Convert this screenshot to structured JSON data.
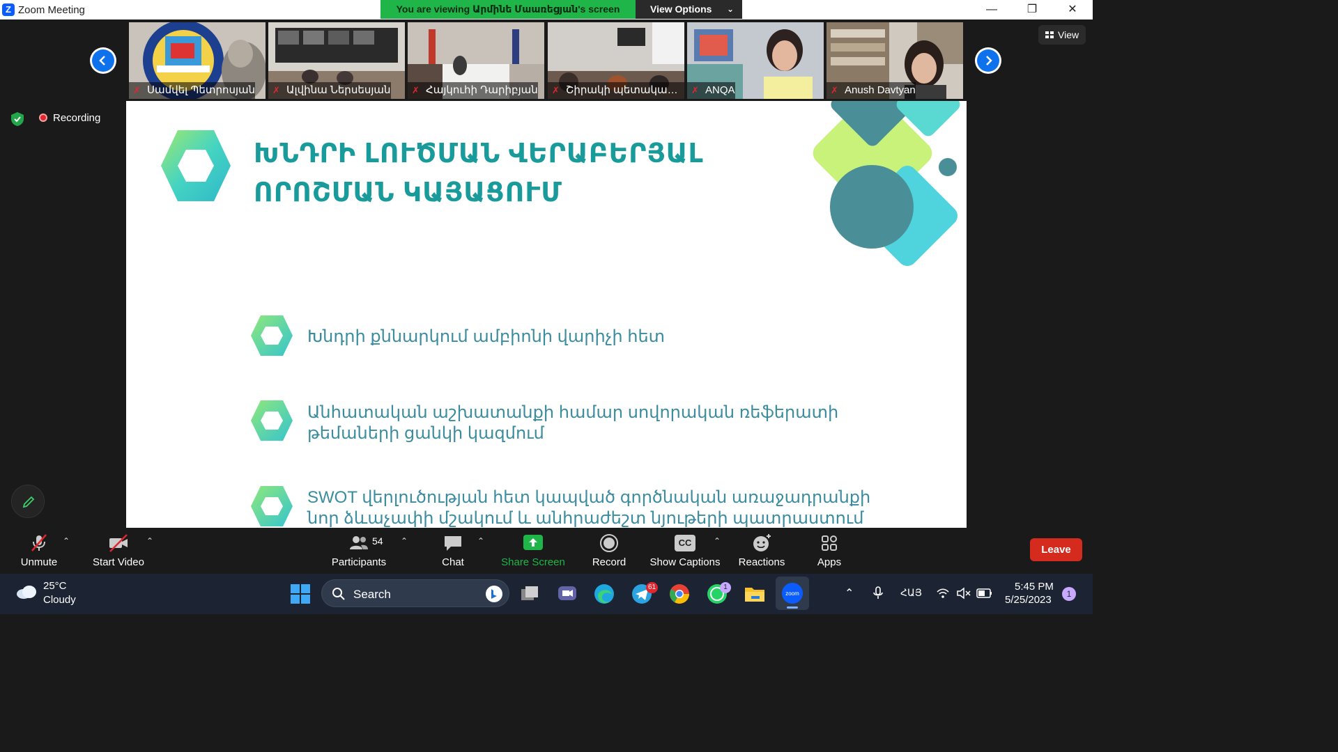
{
  "window": {
    "logo_letter": "Z",
    "title": "Zoom Meeting",
    "minimize": "—",
    "restore": "❐",
    "close": "✕"
  },
  "banner": {
    "text": "You are viewing Արմինե Մաառեցյան's screen",
    "view_options": "View Options"
  },
  "participants_strip": [
    {
      "name": "Սամվել Պետրոսյան"
    },
    {
      "name": "Ալվինա Ներսեսյան"
    },
    {
      "name": "Հայկուհի Դարիբյան"
    },
    {
      "name": "Շիրակի պետական հ..."
    },
    {
      "name": "ANQA"
    },
    {
      "name": "Anush Davtyan"
    }
  ],
  "view_button": "View",
  "recording_label": "Recording",
  "slide": {
    "title_line1": "ԽՆԴՐԻ ԼՈՒԾՄԱՆ ՎԵՐԱԲԵՐՅԱԼ",
    "title_line2": "ՈՐՈՇՄԱՆ ԿԱՅԱՑՈՒՄ",
    "bullets": [
      "Խնդրի քննարկում ամբիոնի վարիչի հետ",
      "Անհատական աշխատանքի համար սովորական ռեֆերատի թեմաների ցանկի կազմում",
      "SWOT վերլուծության հետ կապված գործնական առաջադրանքի նոր ձևաչափի մշակում և անհրաժեշտ նյութերի պատրաստում"
    ],
    "accent_color": "#1a9b9b"
  },
  "toolbar": {
    "unmute": "Unmute",
    "start_video": "Start Video",
    "participants": "Participants",
    "participants_count": "54",
    "chat": "Chat",
    "share_screen": "Share Screen",
    "record": "Record",
    "show_captions": "Show Captions",
    "captions_badge": "CC",
    "reactions": "Reactions",
    "apps": "Apps",
    "leave": "Leave"
  },
  "taskbar": {
    "weather_temp": "25°C",
    "weather_desc": "Cloudy",
    "search_placeholder": "Search",
    "telegram_badge": "61",
    "whatsapp_badge": "1",
    "language": "ՀԱՅ",
    "time": "5:45 PM",
    "date": "5/25/2023",
    "notification_count": "1"
  }
}
